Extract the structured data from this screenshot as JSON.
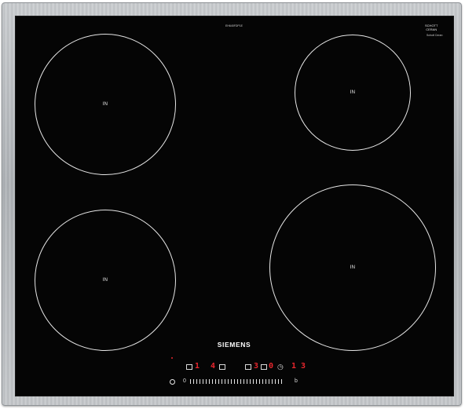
{
  "appliance": {
    "brand": "SIEMENS",
    "model_text": "EH645FDP1E",
    "glass_maker_line1": "SCHOTT",
    "glass_maker_line2": "CERAN",
    "glass_maker_tiny": "Schott Ceran"
  },
  "zones": [
    {
      "id": "front-left",
      "label": "IN"
    },
    {
      "id": "rear-left",
      "label": "IN"
    },
    {
      "id": "rear-right",
      "label": "IN"
    },
    {
      "id": "front-right",
      "label": "IN"
    }
  ],
  "controls": {
    "power_symbol": "ⓘ",
    "slider_min": "0",
    "slider_max": "b",
    "display_left": "4",
    "display_mid": "3",
    "display_mid2": "0",
    "display_right": "1 3",
    "timer_symbol": "◷",
    "indicator_color": "#e8262d"
  }
}
